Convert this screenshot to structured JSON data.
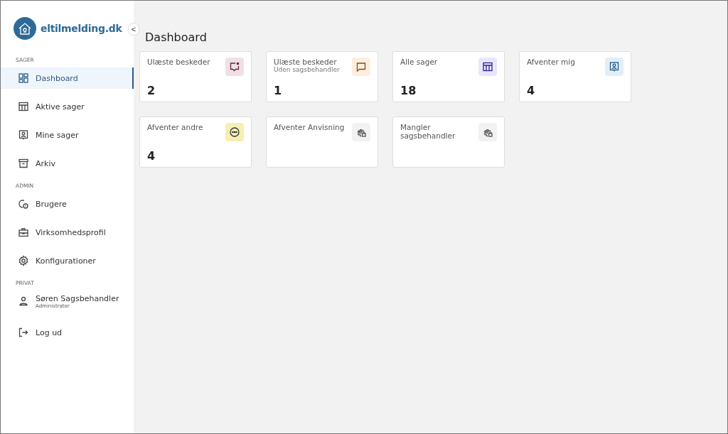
{
  "brand": {
    "name": "eltilmelding.dk",
    "collapse": "<"
  },
  "sidebar": {
    "sections": [
      {
        "heading": "SAGER",
        "items": [
          {
            "label": "Dashboard",
            "kind": "grid",
            "selected": true
          },
          {
            "label": "Aktive sager",
            "kind": "table",
            "selected": false
          },
          {
            "label": "Mine sager",
            "kind": "portrait",
            "selected": false
          },
          {
            "label": "Arkiv",
            "kind": "archive",
            "selected": false
          }
        ]
      },
      {
        "heading": "ADMIN",
        "items": [
          {
            "label": "Brugere",
            "kind": "users",
            "selected": false
          },
          {
            "label": "Virksomhedsprofil",
            "kind": "briefcase",
            "selected": false
          },
          {
            "label": "Konfigurationer",
            "kind": "gear",
            "selected": false
          }
        ]
      },
      {
        "heading": "PRIVAT",
        "items": [
          {
            "label": "Søren Sagsbehandler",
            "sublabel": "Administrator",
            "kind": "person",
            "selected": false
          }
        ]
      }
    ],
    "logout": {
      "label": "Log ud"
    }
  },
  "page_title": "Dashboard",
  "cards": [
    {
      "title": "Ulæste beskeder",
      "value": "2",
      "kind": "chat-dot",
      "color": "#efe0e6"
    },
    {
      "title": "Ulæste beskeder",
      "subtitle": "Uden sagsbehandler",
      "value": "1",
      "kind": "chat",
      "color": "#fcefdf"
    },
    {
      "title": "Alle sager",
      "value": "18",
      "kind": "table",
      "color": "#e8e6fd"
    },
    {
      "title": "Afventer mig",
      "value": "4",
      "kind": "portrait",
      "color": "#e3eef7"
    },
    {
      "title": "Afventer andre",
      "value": "4",
      "kind": "dots",
      "color": "#f6efb4"
    },
    {
      "title": "Afventer Anvisning",
      "kind": "gear-lock",
      "color": "#f2f2f2"
    },
    {
      "title": "Mangler sagsbehandler",
      "kind": "gear-lock",
      "color": "#f2f2f2"
    }
  ]
}
